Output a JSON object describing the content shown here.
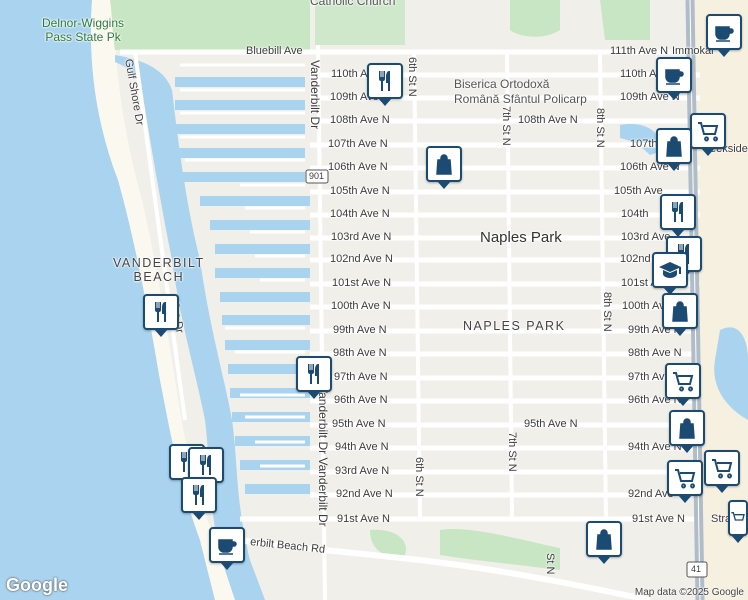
{
  "map": {
    "streets_avenues": [
      "111th Ave N",
      "110th Ave N",
      "109th Ave N",
      "108th Ave N",
      "107th Ave N",
      "106th Ave N",
      "105th Ave N",
      "104th Ave N",
      "103rd Ave N",
      "102nd Ave N",
      "101st Ave N",
      "100th Ave N",
      "99th Ave N",
      "98th Ave N",
      "97th Ave N",
      "96th Ave N",
      "95th Ave N",
      "94th Ave N",
      "93rd Ave N",
      "92nd Ave N",
      "91st Ave N"
    ],
    "street_labels": {
      "bluebill": "Bluebill Ave",
      "ave111": "111th Ave N",
      "ave110_left": "110th Ave N",
      "ave110_right": "110th Ave N",
      "ave109_left": "109th Ave N",
      "ave109_right": "109th Ave N",
      "ave108_left": "108th Ave N",
      "ave108_mid": "108th Ave N",
      "ave107_left": "107th Ave N",
      "ave107_right": "107th Ave N",
      "ave106_left": "106th Ave N",
      "ave106_right": "106th Ave N",
      "ave105_left": "105th Ave N",
      "ave105_right": "105th Ave",
      "ave104_left": "104th Ave N",
      "ave104_right": "104th",
      "ave103_left": "103rd Ave N",
      "ave103_right": "103rd Ave",
      "ave102_left": "102nd Ave N",
      "ave102_right": "102nd",
      "ave101_left": "101st Ave N",
      "ave101_right": "101st A",
      "ave100_left": "100th Ave N",
      "ave100_right": "100th Ave",
      "ave99_left": "99th Ave N",
      "ave99_right": "99th Ave N",
      "ave98_left": "98th Ave N",
      "ave98_right": "98th Ave N",
      "ave97_left": "97th Ave N",
      "ave97_right": "97th Ave",
      "ave96_left": "96th Ave N",
      "ave96_right": "96th Ave N",
      "ave95_left": "95th Ave N",
      "ave95_mid": "95th Ave N",
      "ave94_left": "94th Ave N",
      "ave94_right": "94th Ave N",
      "ave93_left": "93rd Ave N",
      "ave92_left": "92nd Ave N",
      "ave92_right": "92nd Ave",
      "ave91_left": "91st Ave N",
      "ave91_right": "91st Ave N",
      "st6_top": "6th St N",
      "st6_bottom": "6th St N",
      "st7_top": "7th St N",
      "st7_bottom": "7th St N",
      "st8_top": "8th St N",
      "st8_mid": "8th St N",
      "st8_bottom": "8th St N",
      "vanderbilt_dr": "Vanderbilt Dr",
      "vanderbilt_dr2": "Vanderbilt Dr Vanderbilt Dr",
      "gulf_shore": "Gulf Shore Dr",
      "gulf_shore2": "G    e Dr",
      "vb_beach_rd": "erbilt Beach Rd",
      "strand": "Stra",
      "eekside": "eekside",
      "immokalee": "Immokal",
      "rt901": "901",
      "rt41": "41",
      "partial_st": "St N"
    },
    "places": {
      "park": "Delnor-Wiggins\nPass State Pk",
      "church_top": "Catholic Church",
      "church": "Biserica Ortodoxă\nRomână Sfântul Policarp",
      "naples_park": "Naples Park",
      "naples_park_caps": "NAPLES PARK",
      "vanderbilt_beach": "VANDERBILT\nBEACH"
    },
    "markers": [
      {
        "type": "restaurant",
        "icon": "fork-knife-icon"
      },
      {
        "type": "shopping",
        "icon": "shopping-bag-icon"
      },
      {
        "type": "cafe",
        "icon": "coffee-cup-icon"
      },
      {
        "type": "grocery",
        "icon": "shopping-cart-icon"
      },
      {
        "type": "school",
        "icon": "graduation-cap-icon"
      }
    ],
    "footer": {
      "google": "Google",
      "attribution": "Map data ©2025 Google"
    },
    "colors": {
      "water": "#a9d3ef",
      "land": "#f1efe9",
      "park": "#c8e6c4",
      "road": "#ffffff",
      "highway": "#b0bcc7",
      "marker_border": "#1b4a72"
    }
  }
}
